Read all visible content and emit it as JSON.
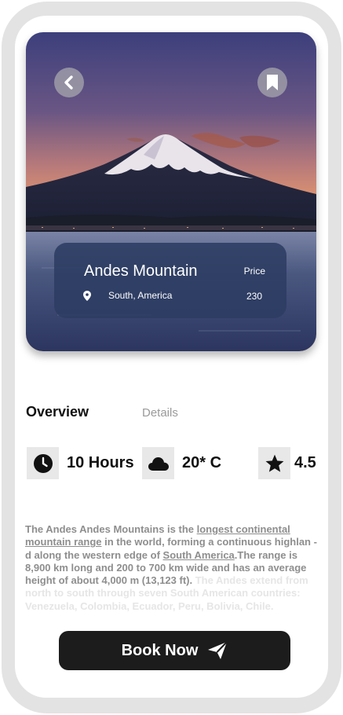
{
  "hero": {
    "title": "Andes Mountain",
    "location": "South, America",
    "price_label": "Price",
    "price": "230"
  },
  "tabs": {
    "overview": "Overview",
    "details": "Details"
  },
  "stats": {
    "duration": "10 Hours",
    "temperature": "20* C",
    "rating": "4.5"
  },
  "description": {
    "p1": "The Andes Andes Mountains is the ",
    "link1": "longest continental mountain range",
    "p2": " in the world, forming a continuous highlan -d along the western edge of ",
    "link2": "South America",
    "p3": ".The range is 8,900 km long and 200 to 700 km wide and has an average height of about 4,000 m (13,123 ft).",
    "faded": " The Andes extend from north to south through seven South American countries: Venezuela, Colombia, Ecuador, Peru, Bolivia, Chile."
  },
  "cta": {
    "book_label": "Book Now"
  },
  "icons": {
    "back": "back-arrow-icon",
    "bookmark": "bookmark-icon",
    "location": "location-pin-icon",
    "clock": "clock-icon",
    "cloud": "cloud-icon",
    "star": "star-icon",
    "send": "paper-plane-icon"
  },
  "colors": {
    "card_bg": "#2c3c62",
    "button_bg": "#1c1c1c",
    "frame": "#e3e3e4"
  }
}
